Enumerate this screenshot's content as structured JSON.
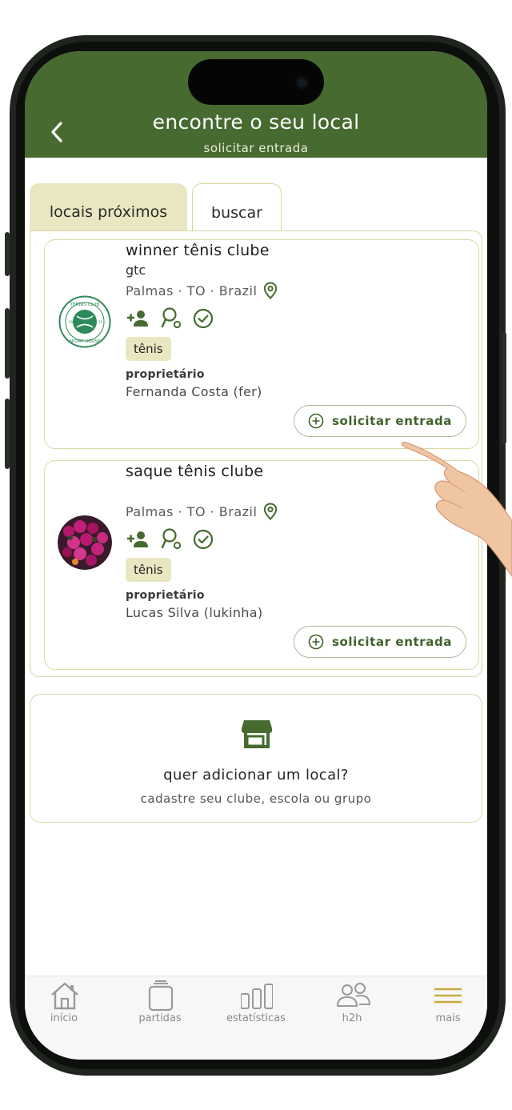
{
  "header": {
    "title": "encontre o seu local",
    "subtitle": "solicitar entrada"
  },
  "tabs": [
    {
      "label": "locais próximos",
      "active": true
    },
    {
      "label": "buscar",
      "active": false
    }
  ],
  "clubs": [
    {
      "name": "winner tênis clube",
      "abbr": "gtc",
      "location": "Palmas · TO · Brazil",
      "sport_tag": "tênis",
      "owner_label": "proprietário",
      "owner_name": "Fernanda Costa (fer)",
      "request_label": "solicitar entrada",
      "logo_text_top": "TENNIS CLUB",
      "logo_text_bottom": "SPORT HOUSE"
    },
    {
      "name": "saque tênis clube",
      "location": "Palmas · TO · Brazil",
      "sport_tag": "tênis",
      "owner_label": "proprietário",
      "owner_name": "Lucas Silva (lukinha)",
      "request_label": "solicitar entrada"
    }
  ],
  "add_local": {
    "title": "quer adicionar um local?",
    "subtitle": "cadastre seu clube, escola ou grupo"
  },
  "nav": [
    {
      "label": "início",
      "icon": "home-icon"
    },
    {
      "label": "partidas",
      "icon": "partidas-icon"
    },
    {
      "label": "estatísticas",
      "icon": "stats-icon"
    },
    {
      "label": "h2h",
      "icon": "people-icon"
    },
    {
      "label": "mais",
      "icon": "menu-icon"
    }
  ],
  "colors": {
    "brand_green": "#466a2f",
    "accent_beige": "#e9e6c2",
    "border_beige": "#dcd8a6",
    "menu_gold": "#c9aa3a"
  }
}
